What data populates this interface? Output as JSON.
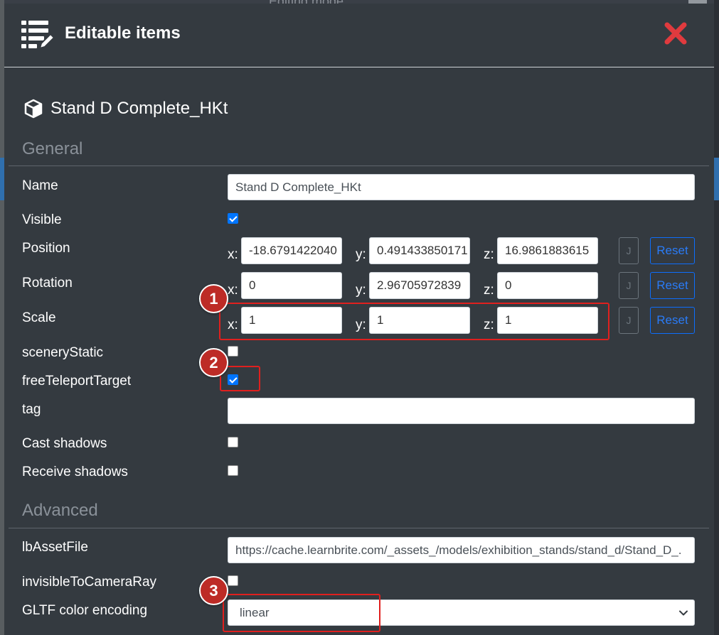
{
  "backdrop": {
    "title": "Editing mode"
  },
  "header": {
    "title": "Editable items",
    "icon": "list-edit-icon",
    "close_icon": "close-icon",
    "close_color": "#e03a3e"
  },
  "item": {
    "title": "Stand D Complete_HKt",
    "icon": "cube-icon"
  },
  "sections": {
    "general": "General",
    "advanced": "Advanced"
  },
  "fields": {
    "name": {
      "label": "Name",
      "value": "Stand D Complete_HKt"
    },
    "visible": {
      "label": "Visible",
      "checked": true
    },
    "position": {
      "label": "Position",
      "x": "-18.6791422040",
      "y": "0.491433850171",
      "z": "16.9861883615"
    },
    "rotation": {
      "label": "Rotation",
      "x": "0",
      "y": "2.96705972839",
      "z": "0"
    },
    "scale": {
      "label": "Scale",
      "x": "1",
      "y": "1",
      "z": "1"
    },
    "sceneryStatic": {
      "label": "sceneryStatic",
      "checked": false
    },
    "freeTeleportTarget": {
      "label": "freeTeleportTarget",
      "checked": true
    },
    "tag": {
      "label": "tag",
      "value": ""
    },
    "castShadows": {
      "label": "Cast shadows",
      "checked": false
    },
    "receiveShadows": {
      "label": "Receive shadows",
      "checked": false
    },
    "lbAssetFile": {
      "label": "lbAssetFile",
      "value": "https://cache.learnbrite.com/_assets_/models/exhibition_stands/stand_d/Stand_D_."
    },
    "invisibleToCameraRay": {
      "label": "invisibleToCameraRay",
      "checked": false
    },
    "gltfColorEncoding": {
      "label": "GLTF color encoding",
      "value": "linear"
    }
  },
  "axis_labels": {
    "x": "x:",
    "y": "y:",
    "z": "z:"
  },
  "buttons": {
    "j": "J",
    "reset": "Reset"
  },
  "callouts": [
    "1",
    "2",
    "3"
  ],
  "colors": {
    "accent": "#0d6efd",
    "callout": "#e0201e",
    "modal_bg": "#343a40"
  }
}
